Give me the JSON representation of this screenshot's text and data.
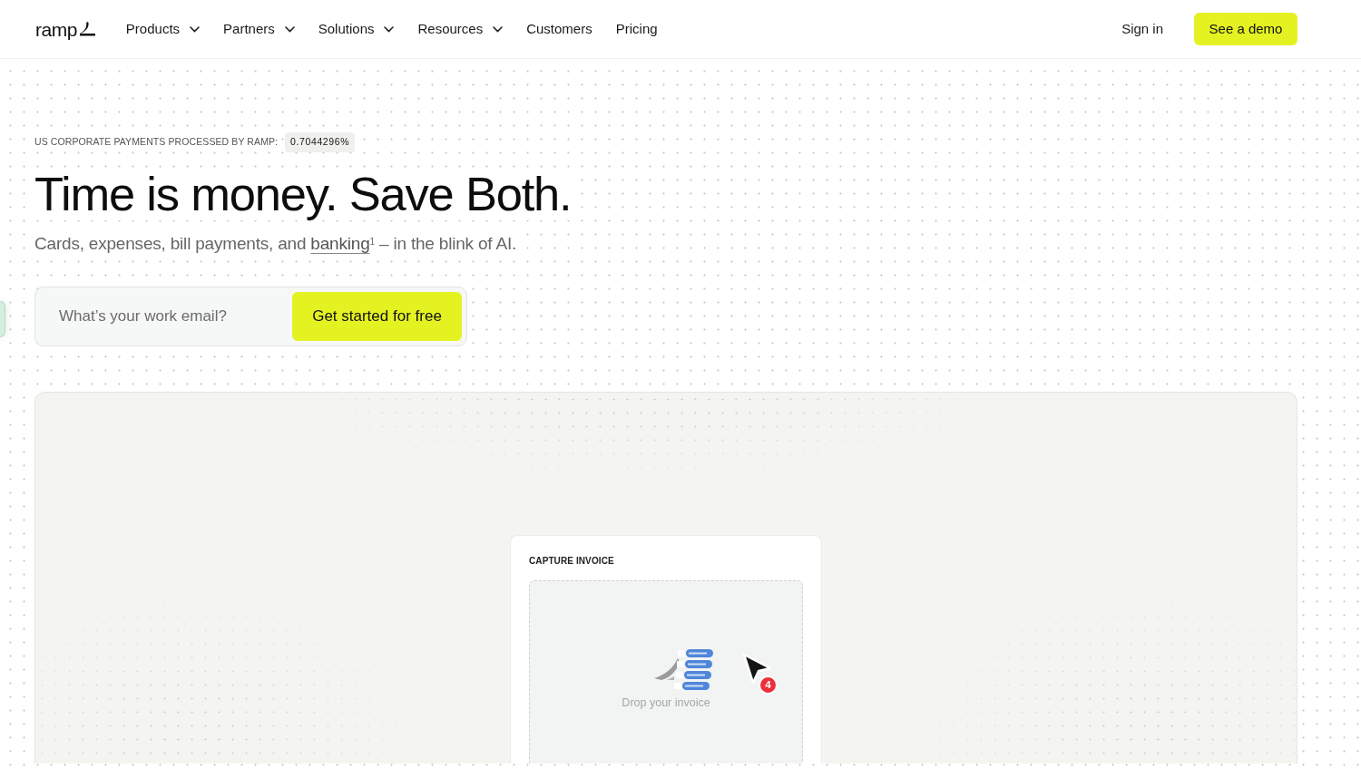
{
  "nav": {
    "logo": "ramp",
    "items": [
      {
        "label": "Products",
        "dropdown": true
      },
      {
        "label": "Partners",
        "dropdown": true
      },
      {
        "label": "Solutions",
        "dropdown": true
      },
      {
        "label": "Resources",
        "dropdown": true
      },
      {
        "label": "Customers",
        "dropdown": false
      },
      {
        "label": "Pricing",
        "dropdown": false
      }
    ],
    "sign_in": "Sign in",
    "demo_button": "See a demo"
  },
  "hero": {
    "stat_label": "US CORPORATE PAYMENTS PROCESSED BY RAMP:",
    "stat_value": "0.7044296%",
    "title": "Time is money. Save Both.",
    "subtitle": {
      "before": "Cards, expenses, bill payments, and ",
      "link": "banking",
      "after": "$^{1}$ – in the blink of AI."
    },
    "email": {
      "placeholder": "What’s your work email?",
      "button": "Get started for free"
    }
  },
  "demo": {
    "card_title": "CAPTURE INVOICE",
    "drop_text": "Drop your invoice",
    "cursor_badge": "4"
  }
}
